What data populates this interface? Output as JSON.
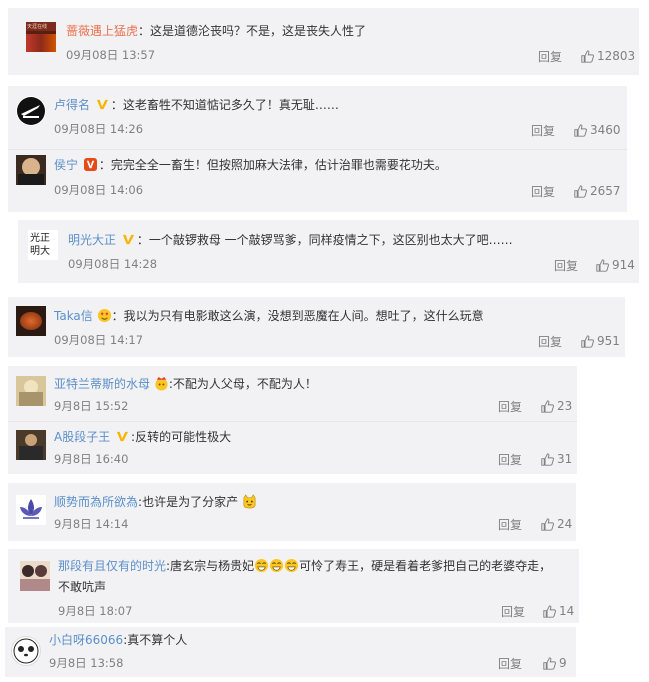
{
  "comments": [
    {
      "user": "蔷薇遇上猛虎",
      "sep": "：",
      "text": "这是道德沦丧吗？不是，这是丧失人性了",
      "time": "09月08日 13:57",
      "reply": "回复",
      "likes": "12803",
      "avatar_text": "天涯在线"
    },
    {
      "user": "卢得名",
      "sep": "：",
      "text": "这老畜牲不知道惦记多久了！真无耻……",
      "time": "09月08日 14:26",
      "reply": "回复",
      "likes": "3460"
    },
    {
      "user": "侯宁",
      "sep": "：",
      "text": "完完全全一畜生！但按照加麻大法律，估计治罪也需要花功夫。",
      "time": "09月08日 14:06",
      "reply": "回复",
      "likes": "2657"
    },
    {
      "user": "明光大正",
      "sep": "：",
      "text": "一个敲锣救母 一个敲锣骂爹，同样疫情之下，这区别也太大了吧……",
      "time": "09月08日 14:28",
      "reply": "回复",
      "likes": "914",
      "avatar_text": "光正明大"
    },
    {
      "user": "Taka信",
      "sep": "：",
      "text": "我以为只有电影敢这么演，没想到恶魔在人间。想吐了，这什么玩意",
      "time": "09月08日 14:17",
      "reply": "回复",
      "likes": "951"
    },
    {
      "user": "亚特兰蒂斯的水母",
      "sep": ":",
      "text": "不配为人父母，不配为人！",
      "time": "9月8日 15:52",
      "reply": "回复",
      "likes": "23"
    },
    {
      "user": "A股段子王",
      "sep": ":",
      "text": "反转的可能性极大",
      "time": "9月8日 16:40",
      "reply": "回复",
      "likes": "31"
    },
    {
      "user": "顺势而為所欲為",
      "sep": ":",
      "text": "也许是为了分家产",
      "time": "9月8日 14:14",
      "reply": "回复",
      "likes": "24"
    },
    {
      "user": "那段有且仅有的时光",
      "sep": ":",
      "text_a": "唐玄宗与杨贵妃",
      "text_b": "可怜了寿王，硬是看着老爹把自己的老婆夺走，",
      "text_c": "不敢吭声",
      "time": "9月8日 18:07",
      "reply": "回复",
      "likes": "14"
    },
    {
      "user": "小白呀66066",
      "sep": ":",
      "text": "真不算个人",
      "time": "9月8日 13:58",
      "reply": "回复",
      "likes": "9"
    }
  ]
}
